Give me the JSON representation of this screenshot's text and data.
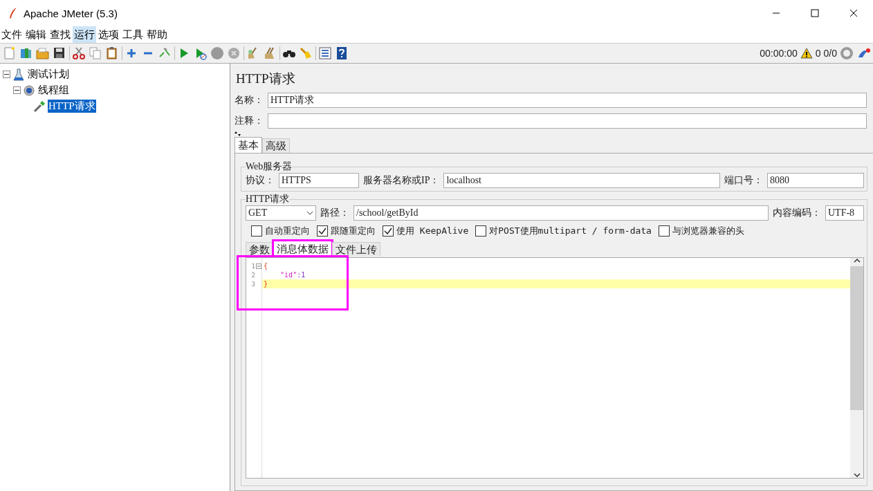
{
  "window": {
    "title": "Apache JMeter (5.3)"
  },
  "menu": [
    {
      "label": "文件",
      "selected": false
    },
    {
      "label": "编辑",
      "selected": false
    },
    {
      "label": "查找",
      "selected": false
    },
    {
      "label": "运行",
      "selected": true
    },
    {
      "label": "选项",
      "selected": false
    },
    {
      "label": "工具",
      "selected": false
    },
    {
      "label": "帮助",
      "selected": false
    }
  ],
  "toolbar_status": {
    "elapsed": "00:00:00",
    "error_count": "0",
    "threads": "0/0"
  },
  "tree": [
    {
      "label": "测试计划",
      "kind": "plan",
      "expanded": true,
      "selected": false,
      "children": [
        {
          "label": "线程组",
          "kind": "thread_group",
          "expanded": true,
          "selected": false,
          "children": [
            {
              "label": "HTTP请求",
              "kind": "sampler",
              "selected": true
            }
          ]
        }
      ]
    }
  ],
  "sampler": {
    "heading": "HTTP请求",
    "name_label": "名称：",
    "name_value": "HTTP请求",
    "comment_label": "注释："
  },
  "tabs": [
    {
      "label": "基本",
      "selected": true
    },
    {
      "label": "高级",
      "selected": false
    }
  ],
  "web_server": {
    "legend": "Web服务器",
    "protocol_label": "协议：",
    "protocol": "HTTPS",
    "server_label": "服务器名称或IP：",
    "server": "localhost",
    "port_label": "端口号：",
    "port": "8080"
  },
  "http_request": {
    "legend": "HTTP请求",
    "method": "GET",
    "path_label": "路径：",
    "path": "/school/getById",
    "encoding_label": "内容编码：",
    "encoding": "UTF-8"
  },
  "options": [
    {
      "label": "自动重定向",
      "checked": false
    },
    {
      "label": "跟随重定向",
      "checked": true
    },
    {
      "label": "使用 KeepAlive",
      "checked": true
    },
    {
      "label": "对POST使用multipart / form-data",
      "checked": false
    },
    {
      "label": "与浏览器兼容的头",
      "checked": false
    }
  ],
  "body_tabs": [
    {
      "label": "参数",
      "selected": false,
      "highlighted": false
    },
    {
      "label": "消息体数据",
      "selected": true,
      "highlighted": true
    },
    {
      "label": "文件上传",
      "selected": false,
      "highlighted": false
    }
  ],
  "editor": {
    "highlighted": true,
    "lines": [
      {
        "number": "1",
        "foldable": true,
        "current": false,
        "tokens": [
          {
            "text": "{",
            "kind": "brace"
          }
        ]
      },
      {
        "number": "2",
        "foldable": false,
        "current": false,
        "tokens": [
          {
            "text": "    \"id\"",
            "kind": "key"
          },
          {
            "text": ":",
            "kind": "punct"
          },
          {
            "text": "1",
            "kind": "number"
          }
        ]
      },
      {
        "number": "3",
        "foldable": false,
        "current": true,
        "tokens": [
          {
            "text": "}",
            "kind": "brace"
          }
        ]
      }
    ]
  }
}
